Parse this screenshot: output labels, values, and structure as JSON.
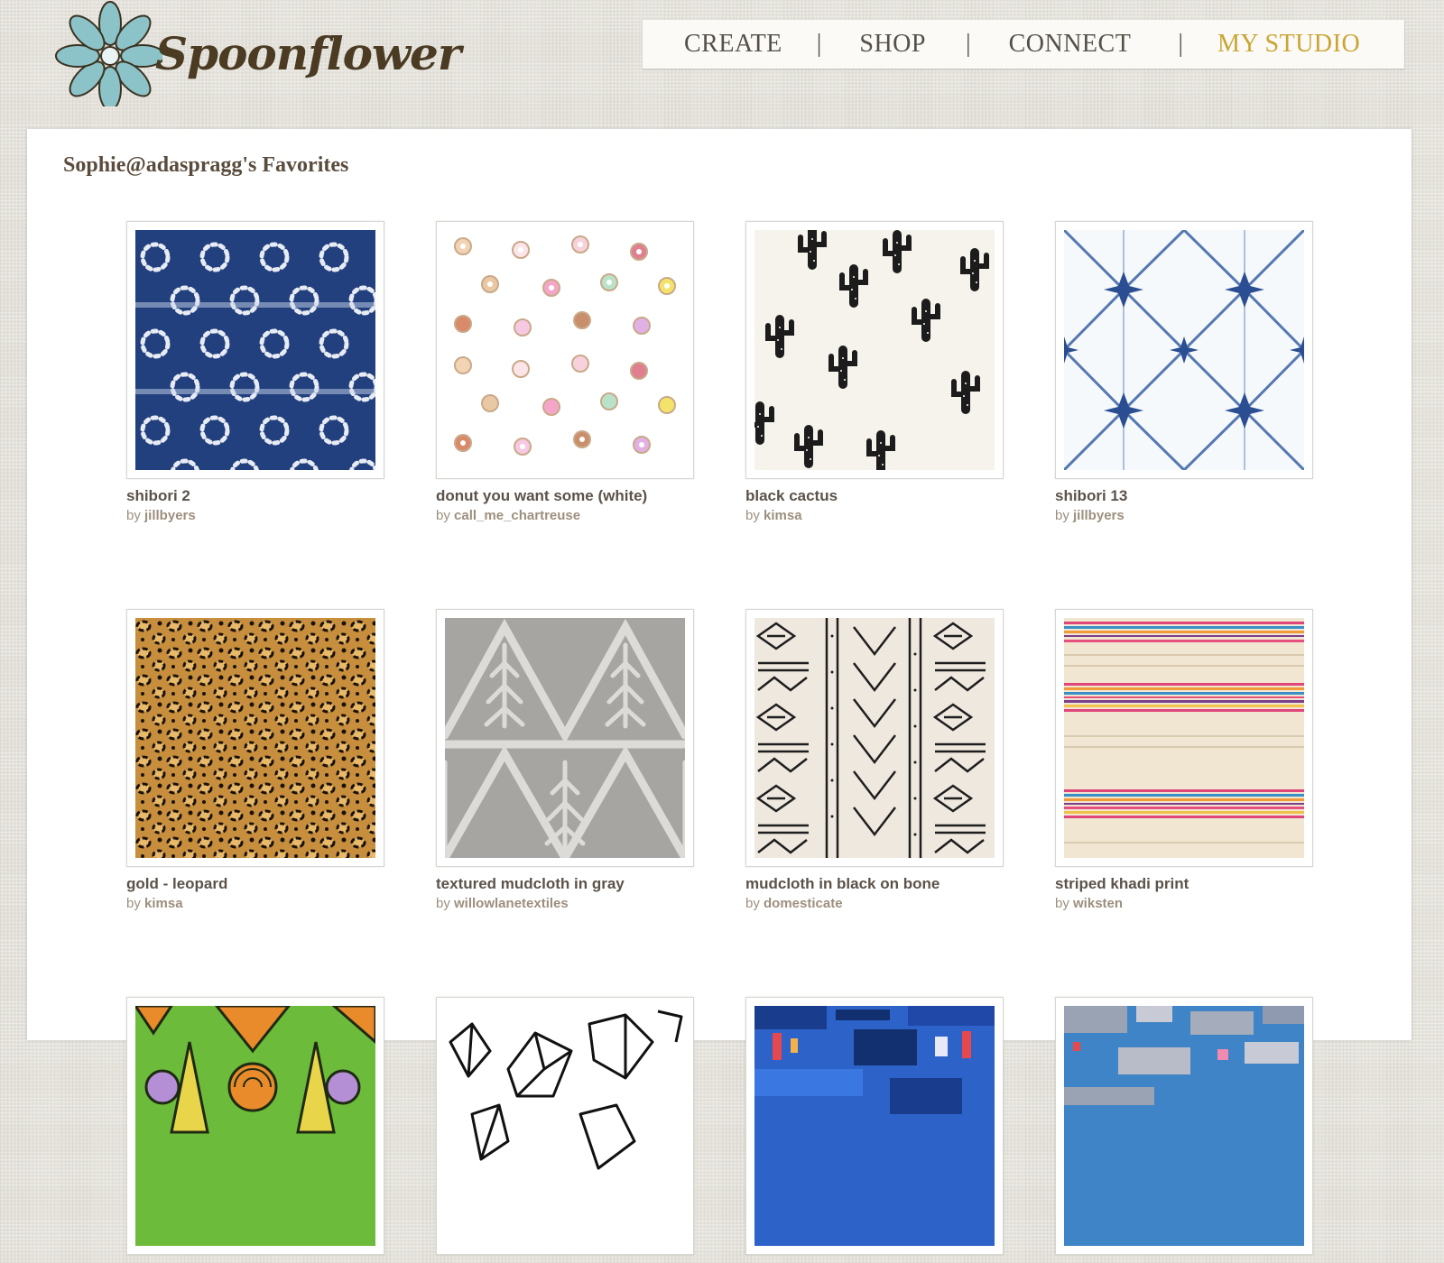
{
  "header": {
    "logo_text": "Spoonflower",
    "nav": [
      {
        "label": "CREATE"
      },
      {
        "label": "SHOP"
      },
      {
        "label": "CONNECT"
      },
      {
        "label": "MY STUDIO"
      }
    ],
    "separator": "|"
  },
  "page": {
    "title": "Sophie@adaspragg's Favorites",
    "by_word": "by"
  },
  "favorites": [
    {
      "name": "shibori 2",
      "designer": "jillbyers"
    },
    {
      "name": "donut you want some (white)",
      "designer": "call_me_chartreuse"
    },
    {
      "name": "black cactus",
      "designer": "kimsa"
    },
    {
      "name": "shibori 13",
      "designer": "jillbyers"
    },
    {
      "name": "gold - leopard",
      "designer": "kimsa"
    },
    {
      "name": "textured mudcloth in gray",
      "designer": "willowlanetextiles"
    },
    {
      "name": "mudcloth in black on bone",
      "designer": "domesticate"
    },
    {
      "name": "striped khadi print",
      "designer": "wiksten"
    },
    {
      "name": "",
      "designer": ""
    },
    {
      "name": "",
      "designer": ""
    },
    {
      "name": "",
      "designer": ""
    },
    {
      "name": "",
      "designer": ""
    }
  ],
  "colors": {
    "nav_text": "#555049",
    "nav_active": "#c9a533",
    "title": "#5a4c3c",
    "item_name": "#5b5249",
    "item_by": "#9c8f7e",
    "logo_flower": "#8cc3c8"
  }
}
